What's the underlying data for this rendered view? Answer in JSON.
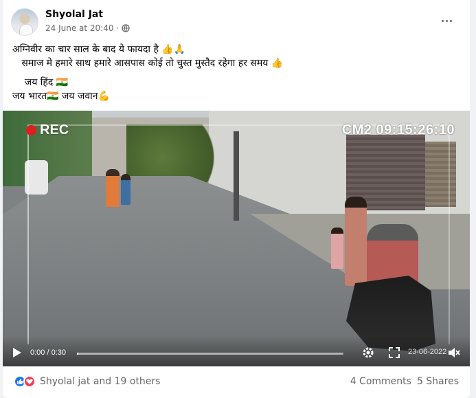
{
  "post": {
    "author": "Shyolal Jat",
    "timestamp": "24 June at 20:40",
    "audience_icon": "globe-icon",
    "menu_icon": "more-options-icon",
    "text_lines": [
      "अग्निवीर का चार साल के बाद ये फायदा है 👍🙏",
      "   समाज मे हमारे साथ हमारे आसपास कोई तो चुस्त मुस्तैद रहेगा हर समय 👍",
      "",
      "    जय हिंद 🇮🇳",
      "जय भारत🇮🇳 जय जवान💪"
    ]
  },
  "video": {
    "overlay_rec": "REC",
    "overlay_stamp": "CM2 09:15:26:10",
    "overlay_date_partial": "23-06-2022",
    "time": "0:00 / 0:30",
    "progress": 0.005,
    "icons": [
      "play-icon",
      "settings-icon",
      "fullscreen-icon",
      "volume-muted-icon"
    ]
  },
  "footer": {
    "reactions_text": "Shyolal jat and 19 others",
    "reaction_icons": [
      "like-icon",
      "love-icon"
    ],
    "comments": "4 Comments",
    "shares": "5 Shares"
  },
  "colors": {
    "accent": "#1877f2",
    "love": "#f33e58",
    "secondary_text": "#65676b"
  }
}
